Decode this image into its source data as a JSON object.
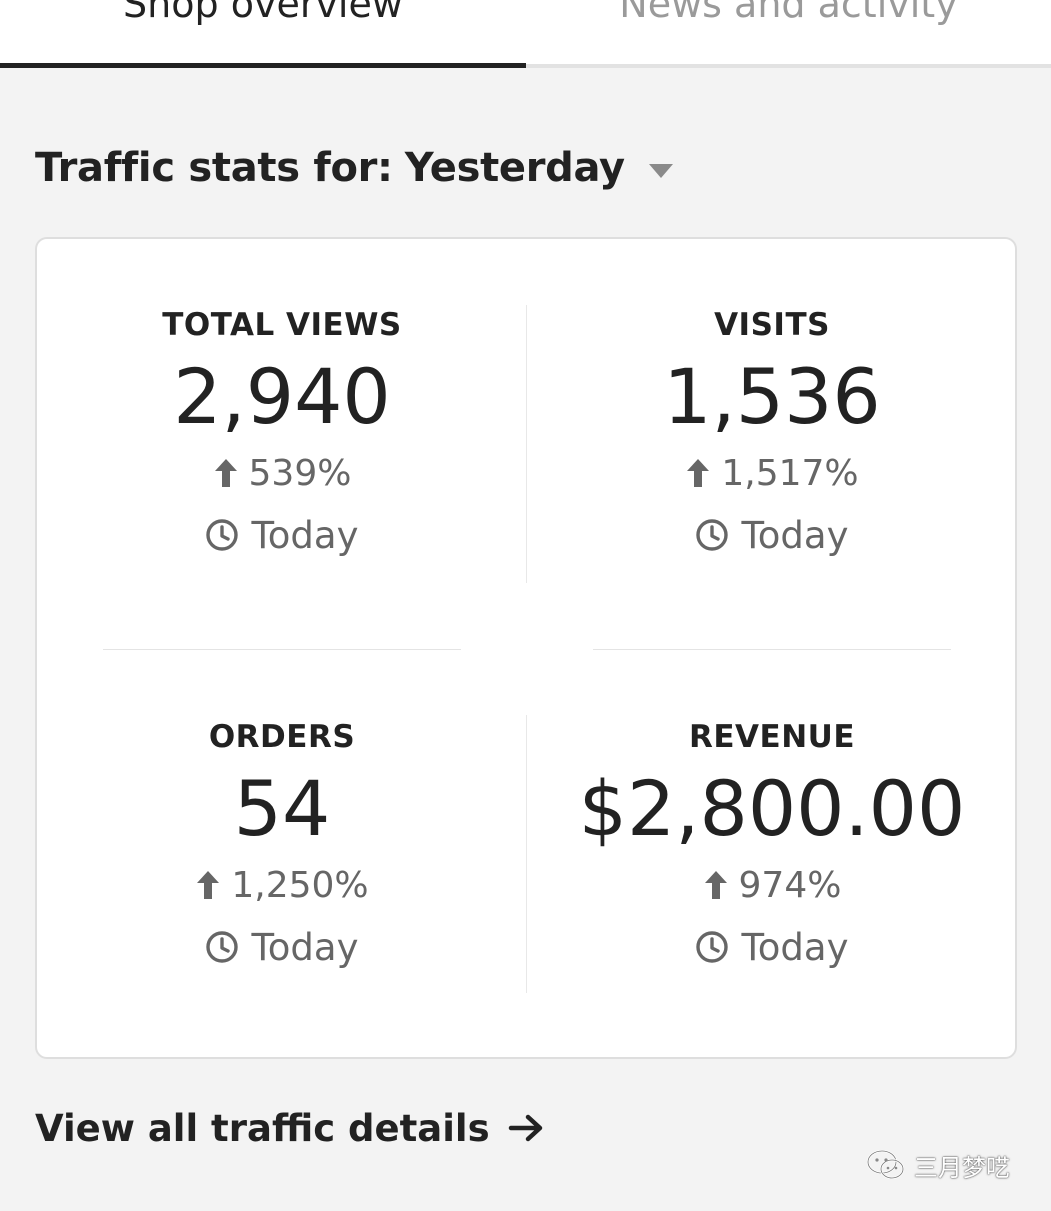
{
  "tabs": [
    {
      "label": "Shop overview",
      "active": true
    },
    {
      "label": "News and activity",
      "active": false
    }
  ],
  "heading": {
    "prefix": "Traffic stats for:",
    "selected_period": "Yesterday",
    "caret_icon": "chevron-down-icon"
  },
  "stats": {
    "total_views": {
      "label": "TOTAL VIEWS",
      "value": "2,940",
      "change": "539%",
      "time": "Today"
    },
    "visits": {
      "label": "VISITS",
      "value": "1,536",
      "change": "1,517%",
      "time": "Today"
    },
    "orders": {
      "label": "ORDERS",
      "value": "54",
      "change": "1,250%",
      "time": "Today"
    },
    "revenue": {
      "label": "REVENUE",
      "value": "$2,800.00",
      "change": "974%",
      "time": "Today"
    }
  },
  "footer": {
    "link_label": "View all traffic details",
    "link_icon": "arrow-right-icon"
  },
  "watermark": {
    "text": "三月梦呓",
    "icon": "wechat-icon"
  },
  "colors": {
    "text_primary": "#222222",
    "text_secondary": "#666666",
    "tab_inactive": "#9a9a9a",
    "background": "#f3f3f3",
    "card": "#ffffff"
  }
}
